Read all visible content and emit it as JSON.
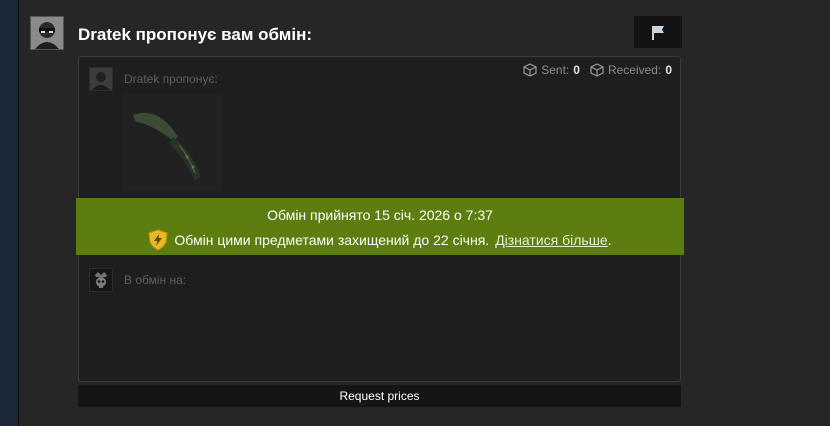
{
  "header": {
    "title": "Dratek пропонує вам обмін:",
    "avatar": "partner-avatar",
    "report_icon": "flag-icon"
  },
  "counts": {
    "sent_label": "Sent:",
    "sent_value": "0",
    "received_label": "Received:",
    "received_value": "0"
  },
  "offer_section": {
    "label": "Dratek пропонує:",
    "item_icon": "knife-icon"
  },
  "return_section": {
    "label": "В обмін на:"
  },
  "banner": {
    "line1": "Обмін прийнято 15 січ. 2026 о 7:37",
    "line2": "Обмін цими предметами захищений до 22 січня.",
    "link": "Дізнатися більше",
    "period": ".",
    "color": "#5c7e10"
  },
  "footer": {
    "request_button": "Request prices"
  }
}
